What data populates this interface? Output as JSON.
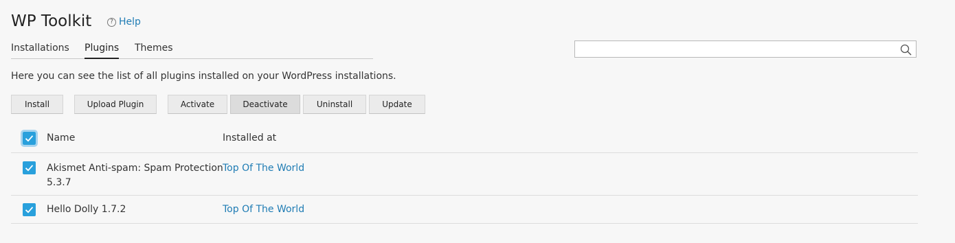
{
  "header": {
    "title": "WP Toolkit",
    "help_label": "Help"
  },
  "tabs": [
    {
      "label": "Installations",
      "active": false
    },
    {
      "label": "Plugins",
      "active": true
    },
    {
      "label": "Themes",
      "active": false
    }
  ],
  "search": {
    "value": "",
    "placeholder": ""
  },
  "description": "Here you can see the list of all plugins installed on your WordPress installations.",
  "toolbar": {
    "install": "Install",
    "upload_plugin": "Upload Plugin",
    "activate": "Activate",
    "deactivate": "Deactivate",
    "uninstall": "Uninstall",
    "update": "Update"
  },
  "table": {
    "columns": {
      "name": "Name",
      "installed_at": "Installed at"
    },
    "select_all_checked": true,
    "rows": [
      {
        "name_line1": "Akismet Anti-spam: Spam Protection",
        "name_line2": "5.3.7",
        "installed_at": "Top Of The World",
        "checked": true
      },
      {
        "name_line1": "Hello Dolly 1.7.2",
        "installed_at": "Top Of The World",
        "checked": true
      }
    ]
  },
  "colors": {
    "accent": "#29a0dc",
    "link": "#1f7cb4",
    "background": "#f7f7f7"
  }
}
